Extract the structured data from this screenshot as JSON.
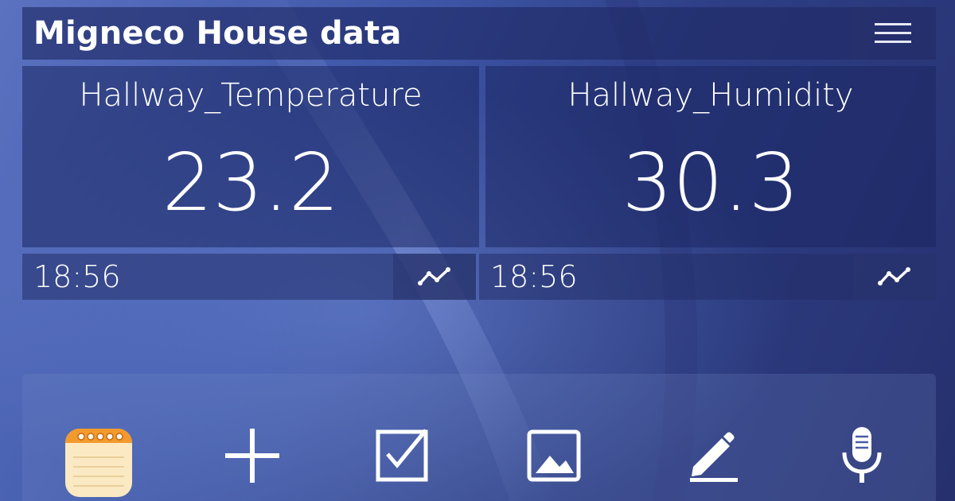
{
  "header": {
    "title": "Migneco House data",
    "menu_icon": "hamburger-menu-icon"
  },
  "widgets": [
    {
      "label": "Hallway_Temperature",
      "value": "23.2",
      "time": "18:56",
      "chart_icon": "trend-line-icon"
    },
    {
      "label": "Hallway_Humidity",
      "value": "30.3",
      "time": "18:56",
      "chart_icon": "trend-line-icon"
    }
  ],
  "dock": {
    "icons": [
      "notepad-app-icon",
      "plus-icon",
      "checkbox-icon",
      "image-icon",
      "pencil-icon",
      "microphone-icon"
    ]
  },
  "colors": {
    "background": "#3f57a8",
    "panel": "#1c2662",
    "text": "#ffffff",
    "notepad_accent": "#f08a24"
  }
}
